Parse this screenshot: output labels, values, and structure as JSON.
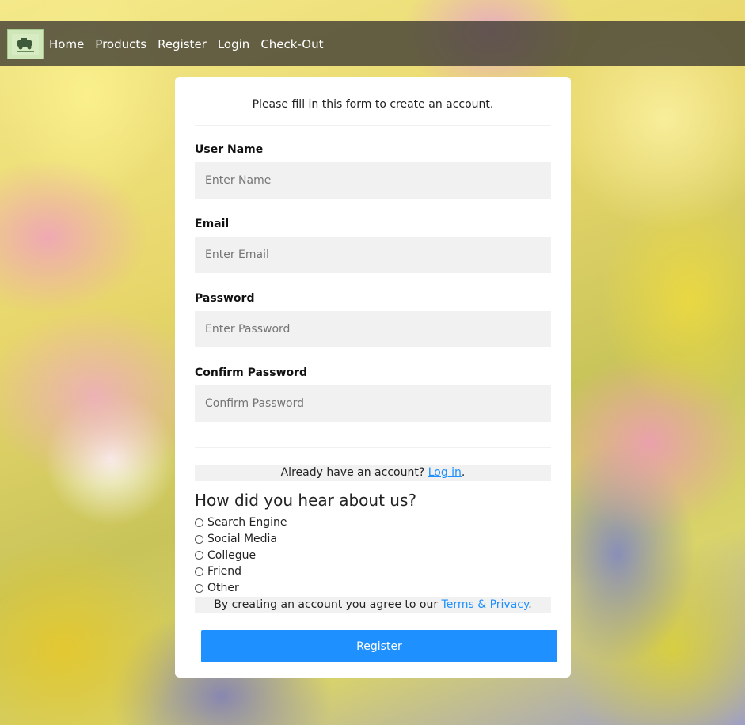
{
  "nav": {
    "logo_icon": "car-logo-icon",
    "links": [
      "Home",
      "Products",
      "Register",
      "Login",
      "Check-Out"
    ]
  },
  "form": {
    "intro": "Please fill in this form to create an account.",
    "fields": [
      {
        "label": "User Name",
        "placeholder": "Enter Name"
      },
      {
        "label": "Email",
        "placeholder": "Enter Email"
      },
      {
        "label": "Password",
        "placeholder": "Enter Password"
      },
      {
        "label": "Confirm Password",
        "placeholder": "Confirm Password"
      }
    ],
    "signin_text": "Already have an account? ",
    "signin_link": "Log in",
    "signin_end": ".",
    "hear_heading": "How did you hear about us?",
    "hear_options": [
      "Search Engine",
      "Social Media",
      "Collegue",
      "Friend",
      "Other"
    ],
    "terms_text": "By creating an account you agree to our ",
    "terms_link": "Terms & Privacy",
    "terms_end": ".",
    "submit_label": "Register"
  },
  "colors": {
    "accent": "#1e90ff",
    "nav_bg": "#3c3a32",
    "input_bg": "#f1f1f1"
  }
}
